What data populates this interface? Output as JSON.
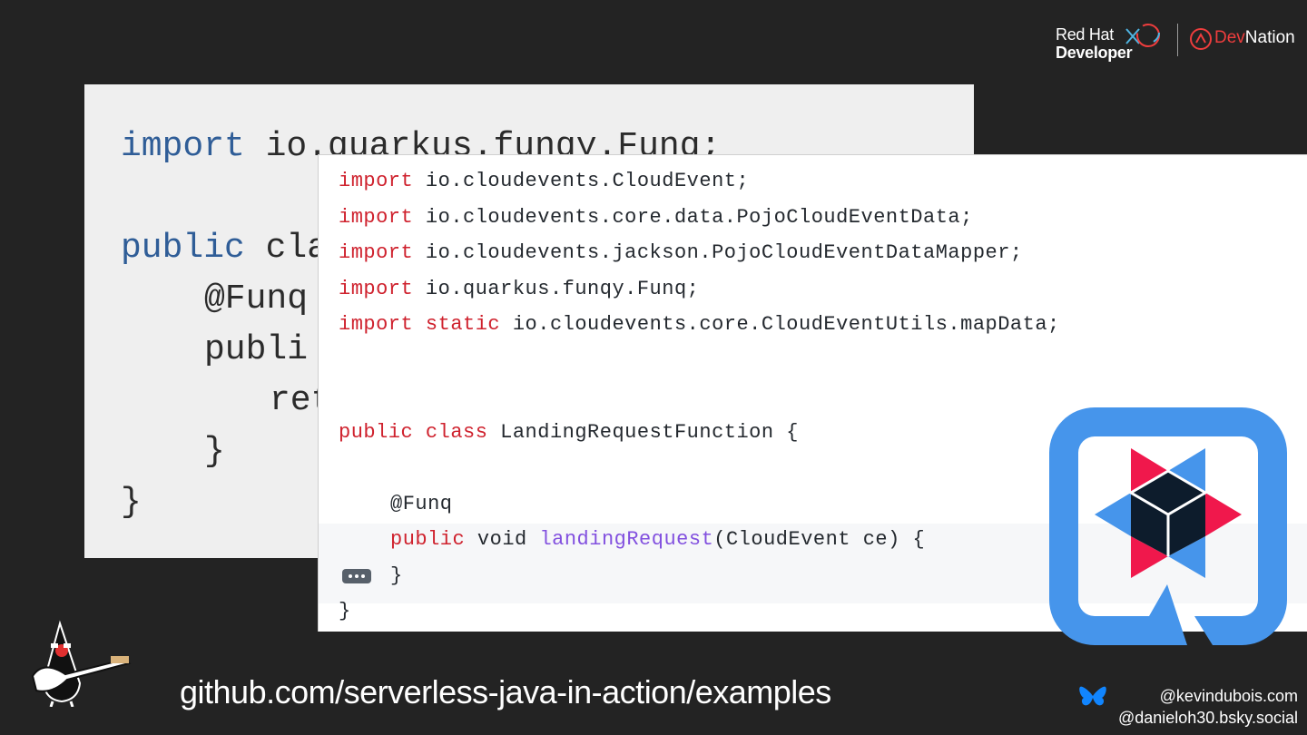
{
  "back_code": {
    "line1_kw": "import",
    "line1_rest": " io.quarkus.funqy.Funq;",
    "line2_kw": "public",
    "line2_rest": " cla",
    "line3": "@Funq",
    "line4": "publi",
    "line5": "ret",
    "line6": "}",
    "line7": "}"
  },
  "front_code": {
    "imports": [
      {
        "kw": "import",
        "rest": " io.cloudevents.CloudEvent;"
      },
      {
        "kw": "import",
        "rest": " io.cloudevents.core.data.PojoCloudEventData;"
      },
      {
        "kw": "import",
        "rest": " io.cloudevents.jackson.PojoCloudEventDataMapper;"
      },
      {
        "kw": "import",
        "rest": " io.quarkus.funqy.Funq;"
      },
      {
        "kw": "import static",
        "rest": " io.cloudevents.core.CloudEventUtils.mapData;"
      }
    ],
    "class_kw": "public class",
    "class_rest": " LandingRequestFunction {",
    "annotation": "@Funq",
    "method_kw": "public",
    "method_type": " void ",
    "method_name": "landingRequest",
    "method_rest": "(CloudEvent ce) {",
    "method_close": "}",
    "class_close": "}"
  },
  "branding": {
    "rh_line1": "Red Hat",
    "rh_line2": "Developer",
    "devnation_a": "Dev",
    "devnation_b": "Nation"
  },
  "footer": {
    "repo_url": "github.com/serverless-java-in-action/examples",
    "handle1": "@kevindubois.com",
    "handle2": "@danieloh30.bsky.social"
  },
  "colors": {
    "background": "#232323",
    "quarkus_blue": "#4695eb",
    "quarkus_red": "#f0184c",
    "keyword_red": "#cf222e"
  }
}
